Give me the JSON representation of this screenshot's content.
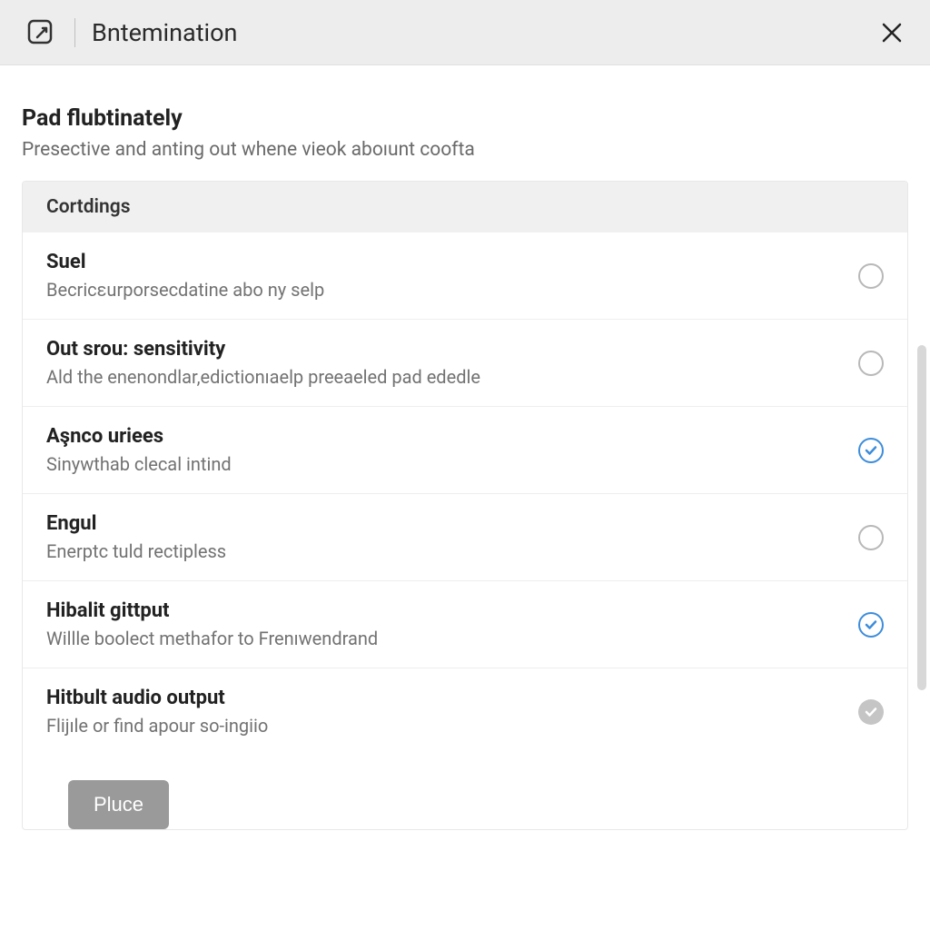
{
  "header": {
    "title": "Bntemination"
  },
  "intro": {
    "title": "Pad flubtinately",
    "subtitle": "Presective and anting out whene vieok aboıunt coofta"
  },
  "section": {
    "header": "Cortdings",
    "options": [
      {
        "title": "Suel",
        "desc": "Becricεurporsecdatine abo ny selp",
        "state": "unchecked"
      },
      {
        "title": "Out srou: sensitivity",
        "desc": "Ald the enenondlar,edictionıaelp preeaeled pad ededle",
        "state": "unchecked"
      },
      {
        "title": "Aşnco uriees",
        "desc": "Sinywthab clecal intind",
        "state": "checked-blue"
      },
      {
        "title": "Engul",
        "desc": "Enerptc tuld rectipless",
        "state": "unchecked"
      },
      {
        "title": "Hibalit gittput",
        "desc": "Willle boolect methafor to Frenıwendrand",
        "state": "checked-blue"
      },
      {
        "title": "Hitbult audio output",
        "desc": "Flijıle or find apour so-ingiio",
        "state": "checked-grey"
      }
    ]
  },
  "footer": {
    "button": "Pluce"
  }
}
